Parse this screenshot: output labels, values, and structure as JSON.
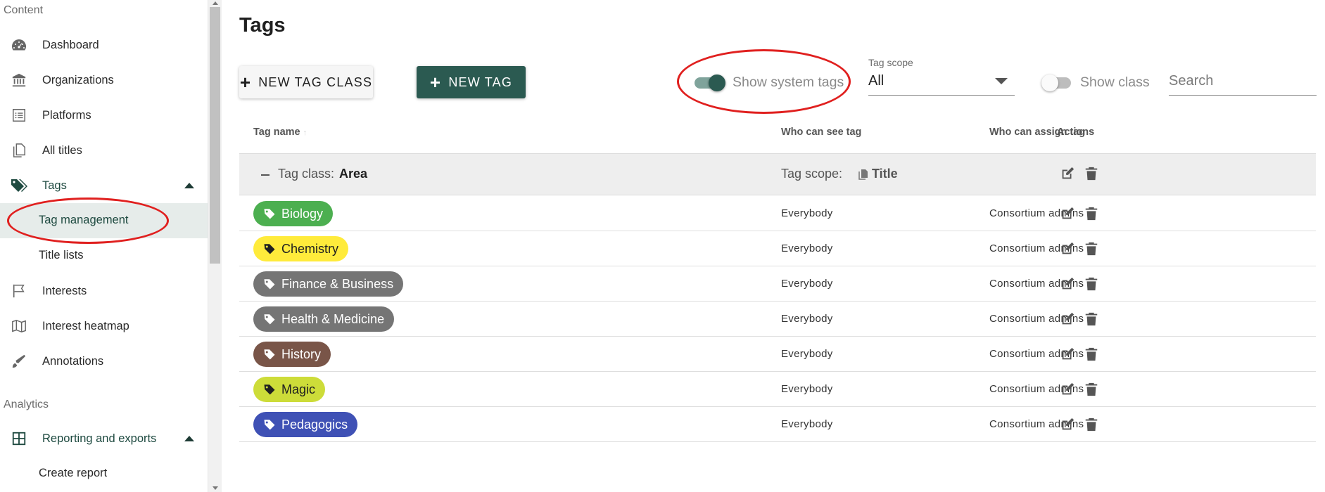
{
  "sidebar": {
    "sections": [
      {
        "label": "Content"
      },
      {
        "label": "Analytics"
      }
    ],
    "items": [
      {
        "label": "Dashboard",
        "icon": "dashboard-icon"
      },
      {
        "label": "Organizations",
        "icon": "bank-icon"
      },
      {
        "label": "Platforms",
        "icon": "list-icon"
      },
      {
        "label": "All titles",
        "icon": "copy-icon"
      },
      {
        "label": "Tags",
        "icon": "tags-icon"
      },
      {
        "label": "Tag management"
      },
      {
        "label": "Title lists"
      },
      {
        "label": "Interests",
        "icon": "flag-icon"
      },
      {
        "label": "Interest heatmap",
        "icon": "map-icon"
      },
      {
        "label": "Annotations",
        "icon": "pen-icon"
      },
      {
        "label": "Reporting and exports",
        "icon": "grid-icon"
      },
      {
        "label": "Create report"
      }
    ]
  },
  "page": {
    "title": "Tags"
  },
  "toolbar": {
    "new_tag_class_label": "NEW TAG CLASS",
    "new_tag_label": "NEW TAG",
    "show_system_tags_label": "Show system tags",
    "show_system_tags_on": true,
    "tag_scope_label": "Tag scope",
    "tag_scope_value": "All",
    "show_class_label": "Show class",
    "show_class_on": false,
    "search_placeholder": "Search"
  },
  "table": {
    "headers": {
      "tag_name": "Tag name",
      "who_can_see": "Who can see tag",
      "who_can_assign": "Who can assign tag",
      "actions": "Actions"
    },
    "tag_class": {
      "label": "Tag class:",
      "name": "Area",
      "scope_label": "Tag scope:",
      "scope_value": "Title"
    },
    "rows": [
      {
        "name": "Biology",
        "color": "#4caf50",
        "text_color": "#ffffff",
        "see": "Everybody",
        "assign": "Consortium admins"
      },
      {
        "name": "Chemistry",
        "color": "#ffeb3b",
        "text_color": "#202020",
        "see": "Everybody",
        "assign": "Consortium admins"
      },
      {
        "name": "Finance & Business",
        "color": "#757575",
        "text_color": "#ffffff",
        "see": "Everybody",
        "assign": "Consortium admins"
      },
      {
        "name": "Health & Medicine",
        "color": "#757575",
        "text_color": "#ffffff",
        "see": "Everybody",
        "assign": "Consortium admins"
      },
      {
        "name": "History",
        "color": "#795548",
        "text_color": "#ffffff",
        "see": "Everybody",
        "assign": "Consortium admins"
      },
      {
        "name": "Magic",
        "color": "#cddc39",
        "text_color": "#202020",
        "see": "Everybody",
        "assign": "Consortium admins"
      },
      {
        "name": "Pedagogics",
        "color": "#3f51b5",
        "text_color": "#ffffff",
        "see": "Everybody",
        "assign": "Consortium admins"
      }
    ]
  },
  "colors": {
    "accent": "#2b5a51",
    "highlight": "#e0201f"
  }
}
